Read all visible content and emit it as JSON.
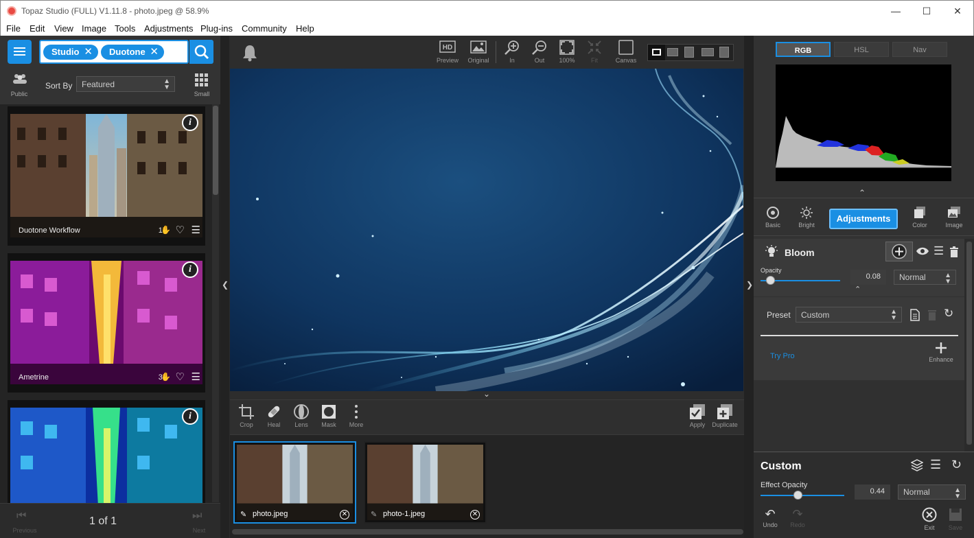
{
  "window": {
    "title": "Topaz Studio (FULL) V1.11.8 - photo.jpeg @ 58.9%"
  },
  "menu": [
    "File",
    "Edit",
    "View",
    "Image",
    "Tools",
    "Adjustments",
    "Plug-ins",
    "Community",
    "Help"
  ],
  "search": {
    "tags": [
      "Studio",
      "Duotone"
    ]
  },
  "filter": {
    "public_label": "Public",
    "sort_label": "Sort By",
    "sort_value": "Featured",
    "small_label": "Small"
  },
  "gallery": [
    {
      "name": "Duotone Workflow",
      "likes": "18"
    },
    {
      "name": "Ametrine",
      "likes": "35"
    },
    {
      "name": "",
      "likes": ""
    }
  ],
  "pager": {
    "prev": "Previous",
    "page": "1 of 1",
    "next": "Next"
  },
  "toolbar": {
    "preview": "Preview",
    "original": "Original",
    "in": "In",
    "out": "Out",
    "full": "100%",
    "fit": "Fit",
    "canvas": "Canvas"
  },
  "tools": {
    "crop": "Crop",
    "heal": "Heal",
    "lens": "Lens",
    "mask": "Mask",
    "more": "More",
    "apply": "Apply",
    "duplicate": "Duplicate"
  },
  "filmstrip": [
    {
      "name": "photo.jpeg"
    },
    {
      "name": "photo-1.jpeg"
    }
  ],
  "histogram": {
    "tabs": [
      "RGB",
      "HSL",
      "Nav"
    ]
  },
  "categories": {
    "basic": "Basic",
    "bright": "Bright",
    "adjustments": "Adjustments",
    "color": "Color",
    "image": "Image"
  },
  "bloom": {
    "title": "Bloom",
    "opacity_label": "Opacity",
    "opacity_value": "0.08",
    "blend": "Normal",
    "opacity_fraction": 0.08
  },
  "preset": {
    "label": "Preset",
    "value": "Custom",
    "try_pro": "Try Pro",
    "enhance": "Enhance"
  },
  "custom": {
    "title": "Custom",
    "effect_label": "Effect Opacity",
    "effect_value": "0.44",
    "blend": "Normal",
    "undo": "Undo",
    "redo": "Redo",
    "exit": "Exit",
    "save": "Save",
    "effect_fraction": 0.44
  },
  "colors": {
    "accent": "#1a8fe3",
    "panel": "#323232"
  }
}
